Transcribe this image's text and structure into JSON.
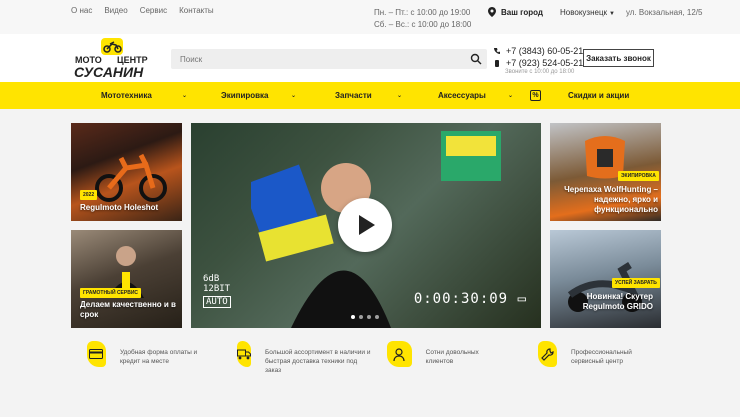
{
  "topbar": {
    "links": [
      "О нас",
      "Видео",
      "Сервис",
      "Контакты"
    ],
    "hours_weekdays": "Пн. – Пт.: с 10:00 до 19:00",
    "hours_weekend": "Сб. – Вс.: с 10:00 до 18:00",
    "city_label": "Ваш город",
    "city_value": "Новокузнецк",
    "address": "ул. Вокзальная, 12/5"
  },
  "header": {
    "search_placeholder": "Поиск",
    "phone_1": "+7 (3843) 60-05-21",
    "phone_2": "+7 (923) 524-05-21",
    "call_note": "Звоните с 10:00 до 18:00",
    "order_call": "Заказать звонок",
    "logo_text": "МОТО ЦЕНТР СУСАНИН"
  },
  "nav": {
    "items": [
      "Мототехника",
      "Экипировка",
      "Запчасти",
      "Аксессуары",
      "Скидки и акции"
    ]
  },
  "tiles": [
    {
      "badge": "2022",
      "title": "Regulmoto Holeshot"
    },
    {
      "badge": "Грамотный сервис",
      "title": "Делаем качественно и в срок"
    },
    {
      "badge": "Экипировка",
      "title": "Черепаха WolfHunting – надежно, ярко и функционально"
    },
    {
      "badge": "Успей забрать",
      "title": "Новинка! Скутер Regulmoto GRIDO"
    }
  ],
  "video": {
    "timecode": "0:00:30:09",
    "osd_line1": "6dB",
    "osd_line2": "12BIT",
    "osd_auto": "AUTO",
    "slides": 4,
    "active_slide": 1
  },
  "features": [
    {
      "icon": "card-icon",
      "text": "Удобная форма оплаты и кредит на месте"
    },
    {
      "icon": "truck-icon",
      "text": "Большой ассортимент в наличии и быстрая доставка техники под заказ"
    },
    {
      "icon": "person-icon",
      "text": "Сотни довольных клиентов"
    },
    {
      "icon": "wrench-icon",
      "text": "Профессиональный сервисный центр"
    }
  ],
  "colors": {
    "accent": "#ffe400",
    "dark": "#222222"
  }
}
